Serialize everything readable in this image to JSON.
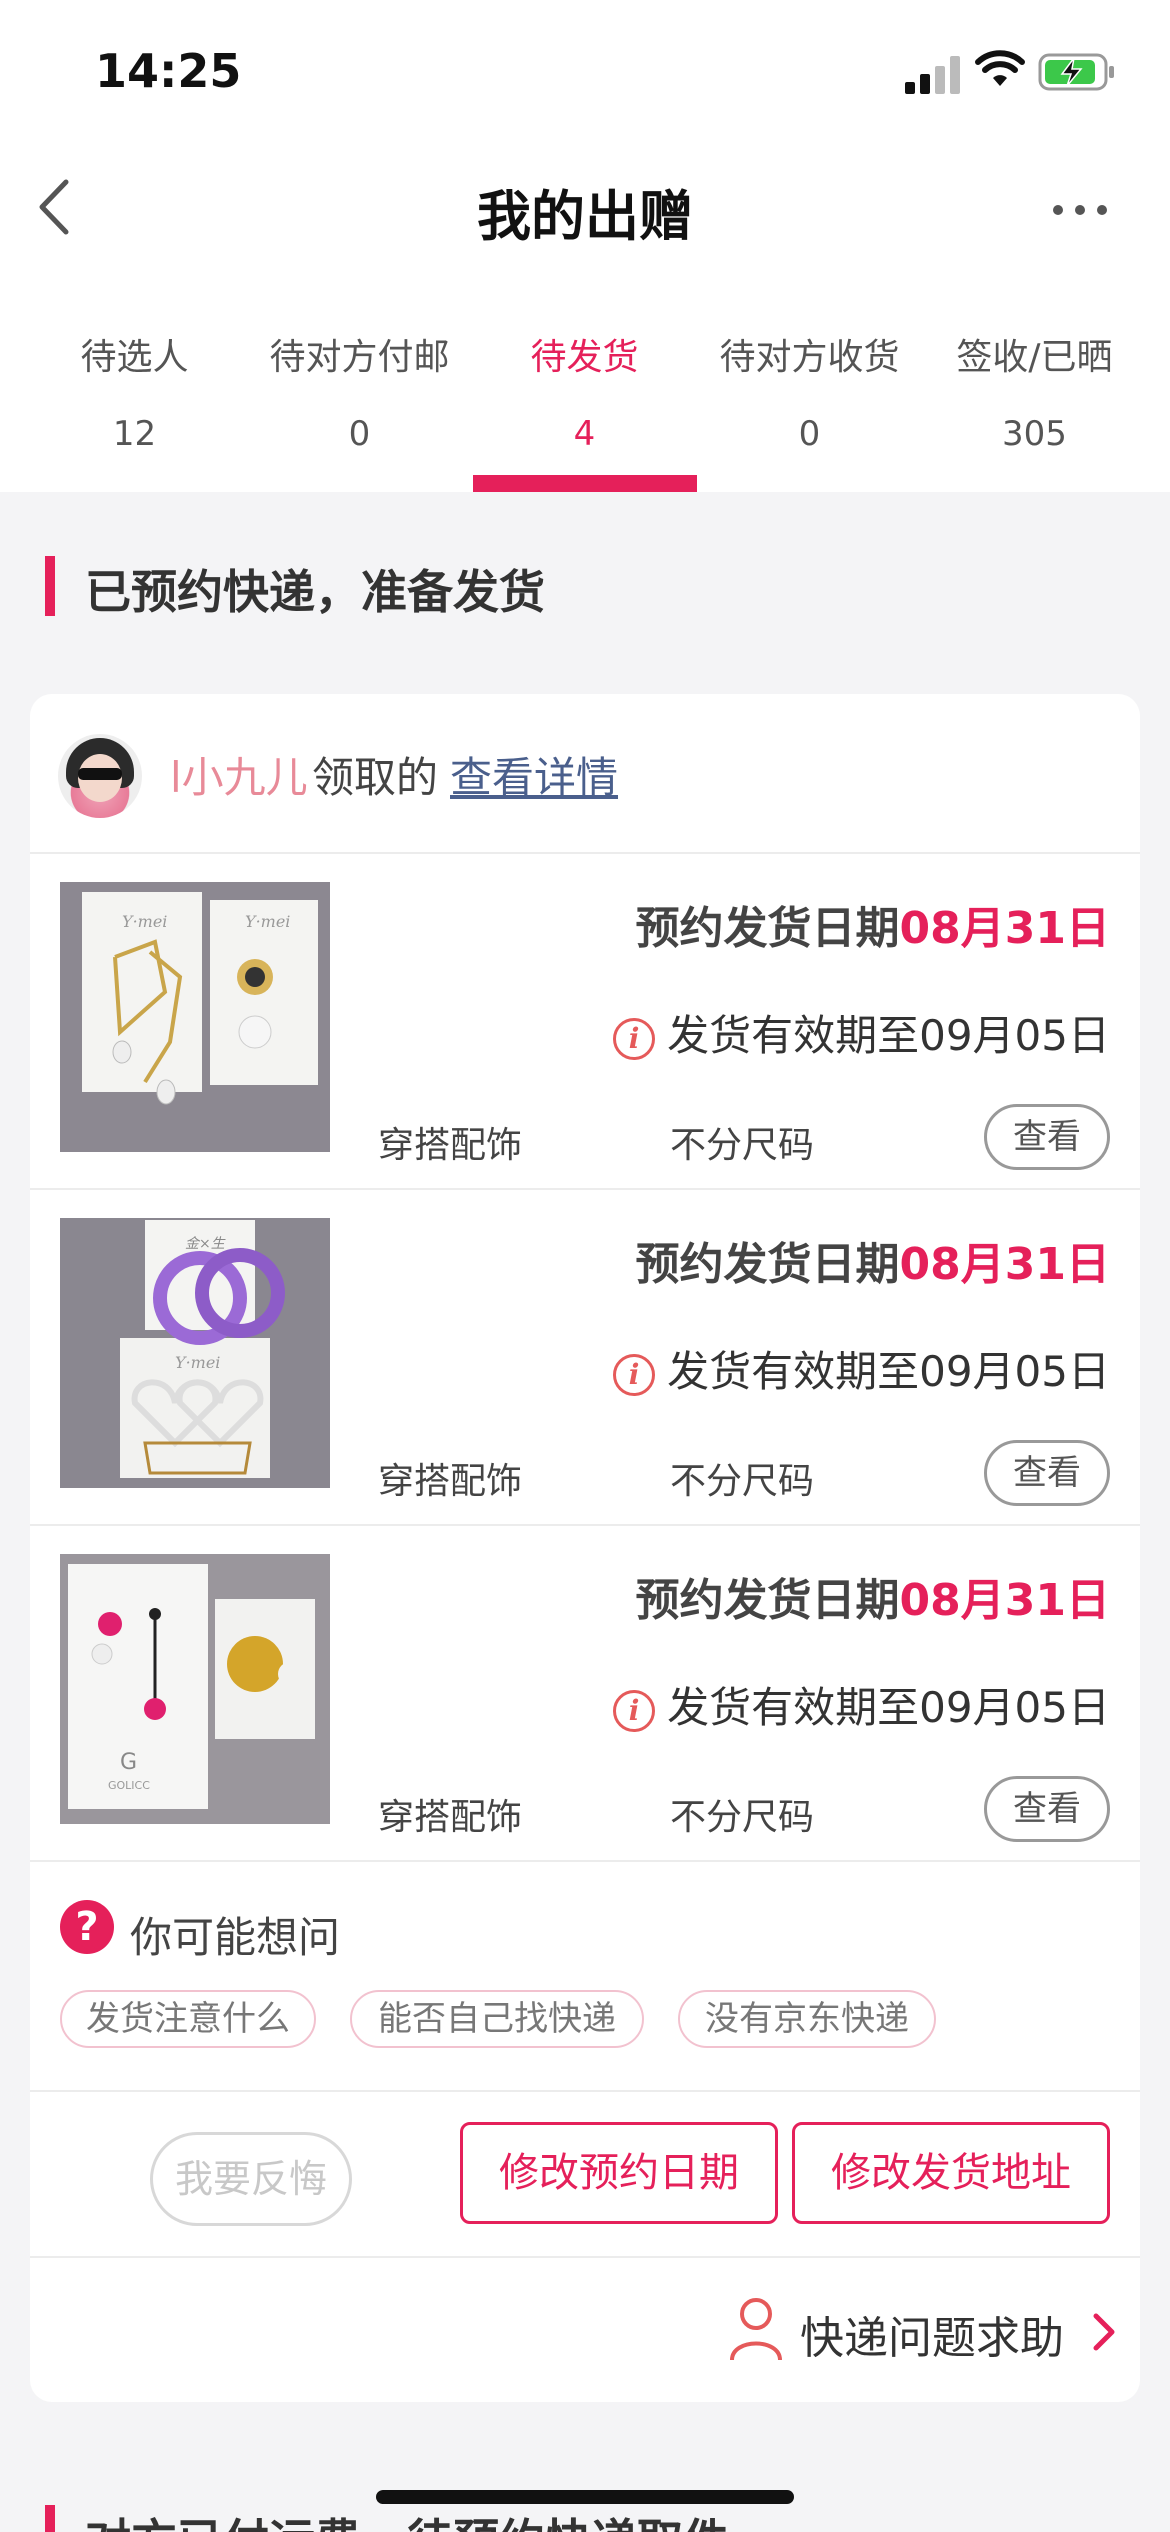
{
  "status_bar": {
    "time": "14:25"
  },
  "nav": {
    "title": "我的出赠"
  },
  "tabs": [
    {
      "label": "待选人",
      "count": "12"
    },
    {
      "label": "待对方付邮",
      "count": "0"
    },
    {
      "label": "待发货",
      "count": "4"
    },
    {
      "label": "待对方收货",
      "count": "0"
    },
    {
      "label": "签收/已晒",
      "count": "305"
    }
  ],
  "active_tab_index": 2,
  "section": {
    "title": "已预约快递，准备发货"
  },
  "order": {
    "receiver_name": "l小九儿",
    "receiver_suffix": "领取的",
    "detail_link": "查看详情",
    "items": [
      {
        "date_label": "预约发货日期",
        "date_value": "08月31日",
        "validity": "发货有效期至09月05日",
        "category": "穿搭配饰",
        "size": "不分尺码",
        "view_label": "查看"
      },
      {
        "date_label": "预约发货日期",
        "date_value": "08月31日",
        "validity": "发货有效期至09月05日",
        "category": "穿搭配饰",
        "size": "不分尺码",
        "view_label": "查看"
      },
      {
        "date_label": "预约发货日期",
        "date_value": "08月31日",
        "validity": "发货有效期至09月05日",
        "category": "穿搭配饰",
        "size": "不分尺码",
        "view_label": "查看"
      }
    ],
    "faq": {
      "title": "你可能想问",
      "chips": [
        "发货注意什么",
        "能否自己找快递",
        "没有京东快递"
      ]
    },
    "actions": {
      "regret": "我要反悔",
      "modify_date": "修改预约日期",
      "modify_address": "修改发货地址"
    },
    "help": "快递问题求助"
  },
  "next_section": {
    "title": "对方已付运费，待预约快递取件"
  },
  "colors": {
    "accent": "#e5205a",
    "link": "#4a5f8c",
    "receiver": "#e88a98"
  }
}
